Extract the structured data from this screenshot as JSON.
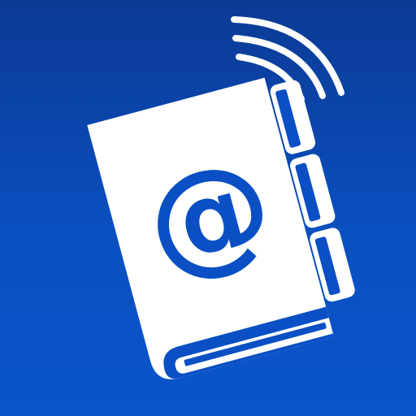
{
  "icon": {
    "name": "address-book-wireless",
    "glyph": "@",
    "colors": {
      "background_top": "#0b3a94",
      "background_bottom": "#0a55cc",
      "foreground": "#ffffff",
      "accent": "#0a4fc4"
    }
  }
}
